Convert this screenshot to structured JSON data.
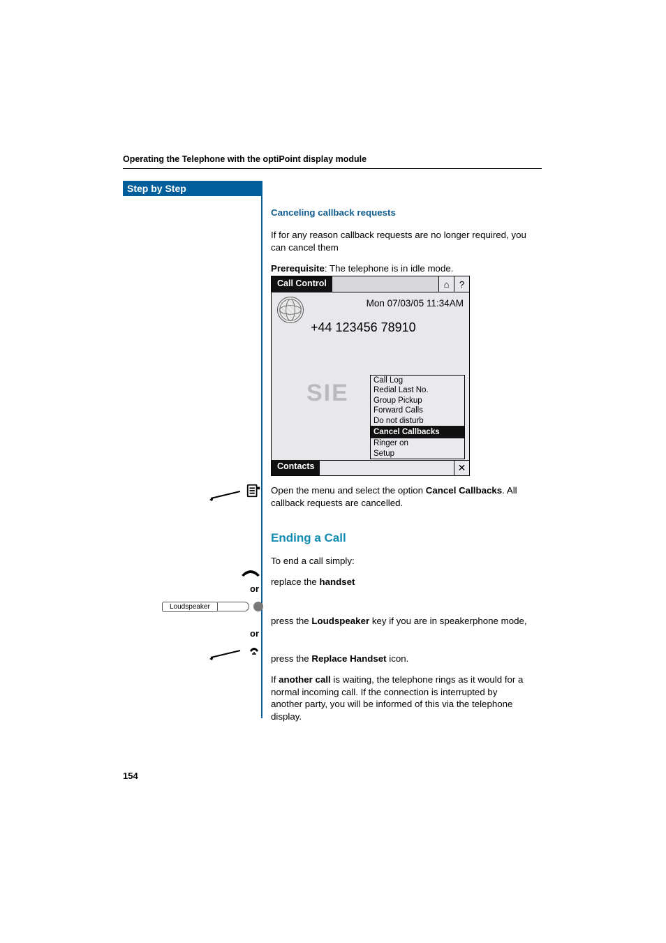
{
  "header": "Operating the Telephone with the optiPoint display module",
  "sidebar_title": "Step by Step",
  "section1": {
    "heading": "Canceling callback requests",
    "intro": "If for any reason callback requests are no longer required, you can cancel them",
    "prereq_label": "Prerequisite",
    "prereq_text": ": The telephone is in idle mode."
  },
  "screen": {
    "top_tab": "Call Control",
    "home_glyph": "⌂",
    "help_glyph": "?",
    "datetime": "Mon 07/03/05 11:34AM",
    "number": "+44 123456 78910",
    "watermark": "SIE",
    "menu": {
      "items_before": [
        "Call Log",
        "Redial Last No.",
        "Group Pickup",
        "Forward Calls",
        "Do not disturb"
      ],
      "selected": "Cancel Callbacks",
      "items_after": [
        "Ringer on",
        "Setup"
      ]
    },
    "bottom_tab": "Contacts",
    "close_glyph": "✕"
  },
  "after_screen": {
    "open_menu_pre": "Open the menu and select the option ",
    "open_menu_bold": "Cancel Callbacks",
    "open_menu_post": ". All callback requests are cancelled."
  },
  "section2": {
    "heading": "Ending a Call",
    "intro": "To end a call simply:",
    "step1_pre": "replace the ",
    "step1_bold": "handset",
    "or": "or",
    "step2_pre": "press the ",
    "step2_bold": "Loudspeaker",
    "step2_post": " key if you are in speakerphone mode,",
    "step3_pre": "press the ",
    "step3_bold": "Replace Handset",
    "step3_post": " icon.",
    "final_pre": "If ",
    "final_bold": "another call",
    "final_post": " is waiting, the telephone rings as it would for a normal incoming call. If the connection is interrupted by another party, you will be informed of this via the telephone display."
  },
  "left": {
    "loudspeaker_key": "Loudspeaker"
  },
  "page_number": "154"
}
